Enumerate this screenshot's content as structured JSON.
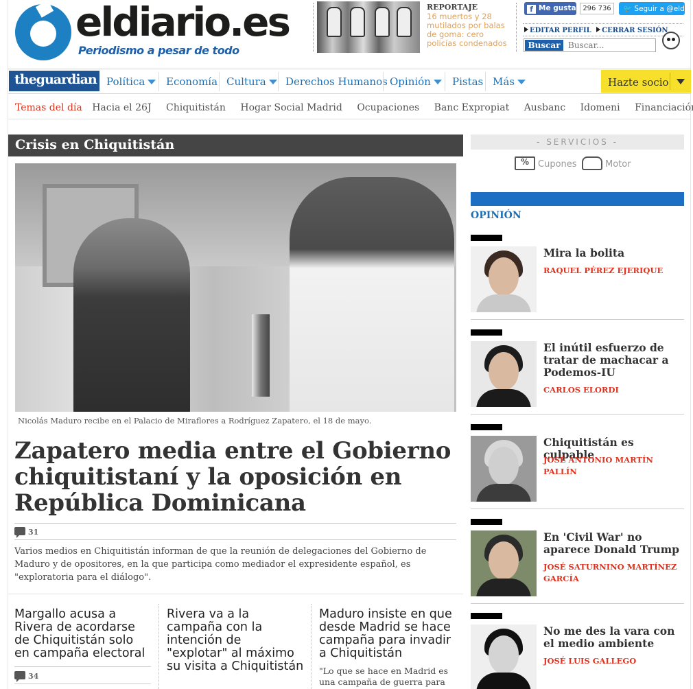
{
  "header": {
    "logo_word": "eldiario.es",
    "logo_tagline": "Periodismo a pesar de todo",
    "promo": {
      "kicker": "REPORTAJE",
      "title": "16 muertos y 28 mutilados por balas de goma: cero policías condenados"
    },
    "social": {
      "fb_like": "Me gusta",
      "fb_count": "296 736",
      "twitter_follow": "Seguir a @eldi"
    },
    "account": {
      "edit_profile": "EDITAR PERFIL",
      "logout": "CERRAR SESIÓN"
    },
    "search": {
      "button": "Buscar",
      "placeholder": "Buscar..."
    }
  },
  "nav": {
    "partner": "theguardian",
    "items": [
      {
        "label": "Política",
        "dropdown": true
      },
      {
        "label": "Economía",
        "dropdown": false
      },
      {
        "label": "Cultura",
        "dropdown": true
      },
      {
        "label": "Derechos Humanos",
        "dropdown": false
      },
      {
        "label": "Opinión",
        "dropdown": true
      },
      {
        "label": "Pistas",
        "dropdown": false
      },
      {
        "label": "Más",
        "dropdown": true
      }
    ],
    "cta": "Hazte socio"
  },
  "topics": {
    "label": "Temas del día",
    "items": [
      "Hacia el 26J",
      "Chiquitistán",
      "Hogar Social Madrid",
      "Ocupaciones",
      "Banc Expropiat",
      "Ausbanc",
      "Idomeni",
      "Financiación PP"
    ]
  },
  "main": {
    "section": "Crisis en Chiquitistán",
    "caption": "Nicolás Maduro recibe en el Palacio de Miraflores a Rodríguez Zapatero, el 18 de mayo.",
    "headline": "Zapatero media entre el Gobierno chiquitistaní y la oposición en República Dominicana",
    "comments": "31",
    "lead": "Varios medios en Chiquitistán informan de que la reunión de delegaciones del Gobierno de Maduro y de opositores, en la que participa como mediador el expresidente español, es \"exploratoria para el diálogo\".",
    "stories": [
      {
        "title": "Margallo acusa a Rivera de acordarse de Chiquitistán solo en campaña electoral",
        "comments": "34",
        "text": ""
      },
      {
        "title": "Rivera va a la campaña con la intención de \"explotar\" al máximo su visita a Chiquitistán",
        "comments": "",
        "text": ""
      },
      {
        "title": "Maduro insiste en que desde Madrid se hace campaña para invadir a Chiquitistán",
        "comments": "",
        "text": "\"Lo que se hace en Madrid es una campaña de guerra para"
      }
    ]
  },
  "sidebar": {
    "services_title": "- SERVICIOS -",
    "services": [
      {
        "label": "Cupones",
        "icon": "coupon-icon"
      },
      {
        "label": "Motor",
        "icon": "car-icon"
      }
    ],
    "opinion_title": "OPINIÓN",
    "opinion": [
      {
        "title": "Mira la bolita",
        "author": "RAQUEL PÉREZ EJERIQUE"
      },
      {
        "title": "El inútil esfuerzo de tratar de machacar a Podemos-IU",
        "author": "CARLOS ELORDI"
      },
      {
        "title": "Chiquitistán es culpable",
        "author": "JOSÉ ANTONIO MARTÍN PALLÍN"
      },
      {
        "title": "En 'Civil War' no aparece Donald Trump",
        "author": "JOSÉ SATURNINO MARTÍNEZ GARCÍA"
      },
      {
        "title": "No me des la vara con el medio ambiente",
        "author": "JOSÉ LUIS GALLEGO"
      }
    ]
  }
}
